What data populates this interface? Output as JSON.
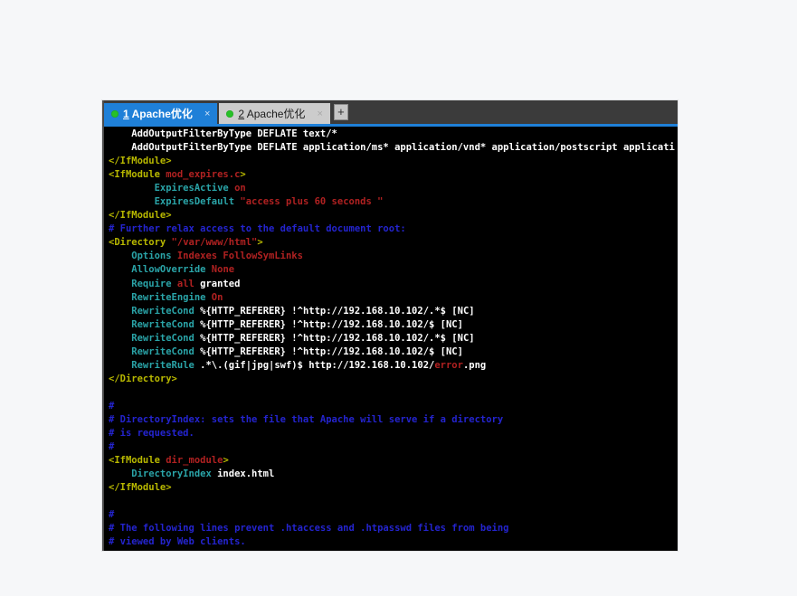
{
  "window": {
    "tabs": [
      {
        "number": "1",
        "title": " Apache优化",
        "state": "active",
        "close_glyph": "×",
        "status": "connected"
      },
      {
        "number": "2",
        "title": " Apache优化",
        "state": "inactive",
        "close_glyph": "×",
        "status": "connected"
      }
    ],
    "new_tab_glyph": "+"
  },
  "colors": {
    "accent_blue": "#1f80d8",
    "status_green": "#27c127",
    "terminal_bg": "#000000",
    "white": "#ffffff",
    "yellow": "#b8b800",
    "red": "#b02121",
    "cyan": "#2aa4a8",
    "blue": "#2424cf"
  },
  "terminal": {
    "lines": [
      [
        [
          "white",
          "    AddOutputFilterByType DEFLATE text/*"
        ]
      ],
      [
        [
          "white",
          "    AddOutputFilterByType DEFLATE application/ms* application/vnd* application/postscript applicati"
        ]
      ],
      [
        [
          "yellow",
          "</IfModule>"
        ]
      ],
      [
        [
          "yellow",
          "<IfModule "
        ],
        [
          "red",
          "mod_expires.c"
        ],
        [
          "yellow",
          ">"
        ]
      ],
      [
        [
          "cyan",
          "        ExpiresActive "
        ],
        [
          "red",
          "on"
        ]
      ],
      [
        [
          "cyan",
          "        ExpiresDefault "
        ],
        [
          "red",
          "\"access plus 60 seconds \""
        ]
      ],
      [
        [
          "yellow",
          "</IfModule>"
        ]
      ],
      [
        [
          "blue",
          "# Further relax access to the default document root:"
        ]
      ],
      [
        [
          "yellow",
          "<Directory "
        ],
        [
          "red",
          "\"/var/www/html\""
        ],
        [
          "yellow",
          ">"
        ]
      ],
      [
        [
          "cyan",
          "    Options "
        ],
        [
          "red",
          "Indexes FollowSymLinks"
        ]
      ],
      [
        [
          "cyan",
          "    AllowOverride "
        ],
        [
          "red",
          "None"
        ]
      ],
      [
        [
          "cyan",
          "    Require "
        ],
        [
          "red",
          "all"
        ],
        [
          "white",
          " granted"
        ]
      ],
      [
        [
          "cyan",
          "    RewriteEngine "
        ],
        [
          "red",
          "On"
        ]
      ],
      [
        [
          "cyan",
          "    RewriteCond "
        ],
        [
          "white",
          "%{HTTP_REFERER} !^http://192.168.10.102/.*$ [NC]"
        ]
      ],
      [
        [
          "cyan",
          "    RewriteCond "
        ],
        [
          "white",
          "%{HTTP_REFERER} !^http://192.168.10.102/$ [NC]"
        ]
      ],
      [
        [
          "cyan",
          "    RewriteCond "
        ],
        [
          "white",
          "%{HTTP_REFERER} !^http://192.168.10.102/.*$ [NC]"
        ]
      ],
      [
        [
          "cyan",
          "    RewriteCond "
        ],
        [
          "white",
          "%{HTTP_REFERER} !^http://192.168.10.102/$ [NC]"
        ]
      ],
      [
        [
          "cyan",
          "    RewriteRule "
        ],
        [
          "white",
          ".*\\.(gif|jpg|swf)$ http://192.168.10.102/"
        ],
        [
          "red",
          "error"
        ],
        [
          "white",
          ".png"
        ]
      ],
      [
        [
          "yellow",
          "</Directory>"
        ]
      ],
      [],
      [
        [
          "blue",
          "#"
        ]
      ],
      [
        [
          "blue",
          "# DirectoryIndex: sets the file that Apache will serve if a directory"
        ]
      ],
      [
        [
          "blue",
          "# is requested."
        ]
      ],
      [
        [
          "blue",
          "#"
        ]
      ],
      [
        [
          "yellow",
          "<IfModule "
        ],
        [
          "red",
          "dir_module"
        ],
        [
          "yellow",
          ">"
        ]
      ],
      [
        [
          "cyan",
          "    DirectoryIndex "
        ],
        [
          "white",
          "index.html"
        ]
      ],
      [
        [
          "yellow",
          "</IfModule>"
        ]
      ],
      [],
      [
        [
          "blue",
          "#"
        ]
      ],
      [
        [
          "blue",
          "# The following lines prevent .htaccess and .htpasswd files from being"
        ]
      ],
      [
        [
          "blue",
          "# viewed by Web clients."
        ]
      ]
    ]
  }
}
